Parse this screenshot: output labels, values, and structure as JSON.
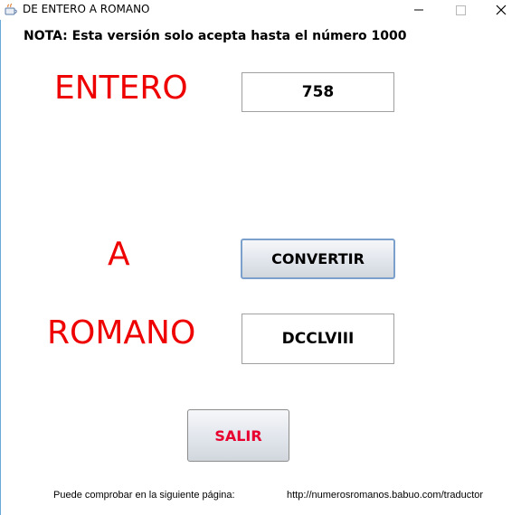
{
  "window": {
    "title": "DE ENTERO A ROMANO",
    "controls": {
      "minimize": "minimize-icon",
      "maximize": "maximize-icon",
      "close": "close-icon"
    }
  },
  "note": "NOTA: Esta versión solo acepta hasta el número 1000",
  "labels": {
    "entero": "ENTERO",
    "a": "A",
    "romano": "ROMANO"
  },
  "fields": {
    "entero_value": "758",
    "romano_value": "DCCLVIII"
  },
  "buttons": {
    "convertir": "CONVERTIR",
    "salir": "SALIR"
  },
  "footer": {
    "text": "Puede comprobar en la siguiente página:",
    "url": "http://numerosromanos.babuo.com/traductor"
  },
  "colors": {
    "label_red": "#ee0000",
    "salir_text": "#e8002f",
    "convertir_border": "#7ca0cc"
  }
}
